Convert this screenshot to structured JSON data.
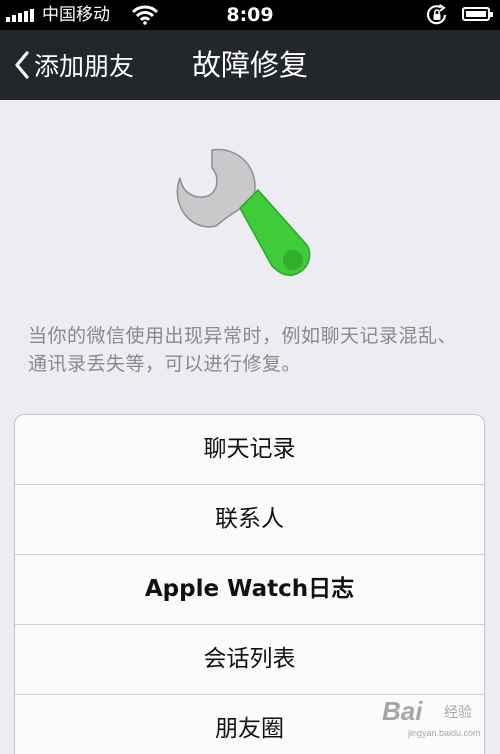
{
  "status_bar": {
    "carrier": "中国移动",
    "time": "8:09"
  },
  "nav": {
    "back_label": "添加朋友",
    "title": "故障修复"
  },
  "description": "当你的微信使用出现异常时，例如聊天记录混乱、通讯录丢失等，可以进行修复。",
  "options": [
    {
      "label": "聊天记录"
    },
    {
      "label": "联系人"
    },
    {
      "label": "Apple Watch日志"
    },
    {
      "label": "会话列表"
    },
    {
      "label": "朋友圈"
    }
  ],
  "watermark": {
    "brand": "Bai",
    "product": "经验",
    "url": "jingyan.baidu.com"
  },
  "colors": {
    "nav_background": "#23272b",
    "page_background": "#ececf2",
    "wrench_handle": "#3fcc3a",
    "wrench_head": "#c8c8c8"
  },
  "icons": {
    "back": "chevron-left-icon",
    "illustration": "wrench-icon",
    "wifi": "wifi-icon",
    "rotation_lock": "rotation-lock-icon",
    "battery": "battery-icon"
  }
}
